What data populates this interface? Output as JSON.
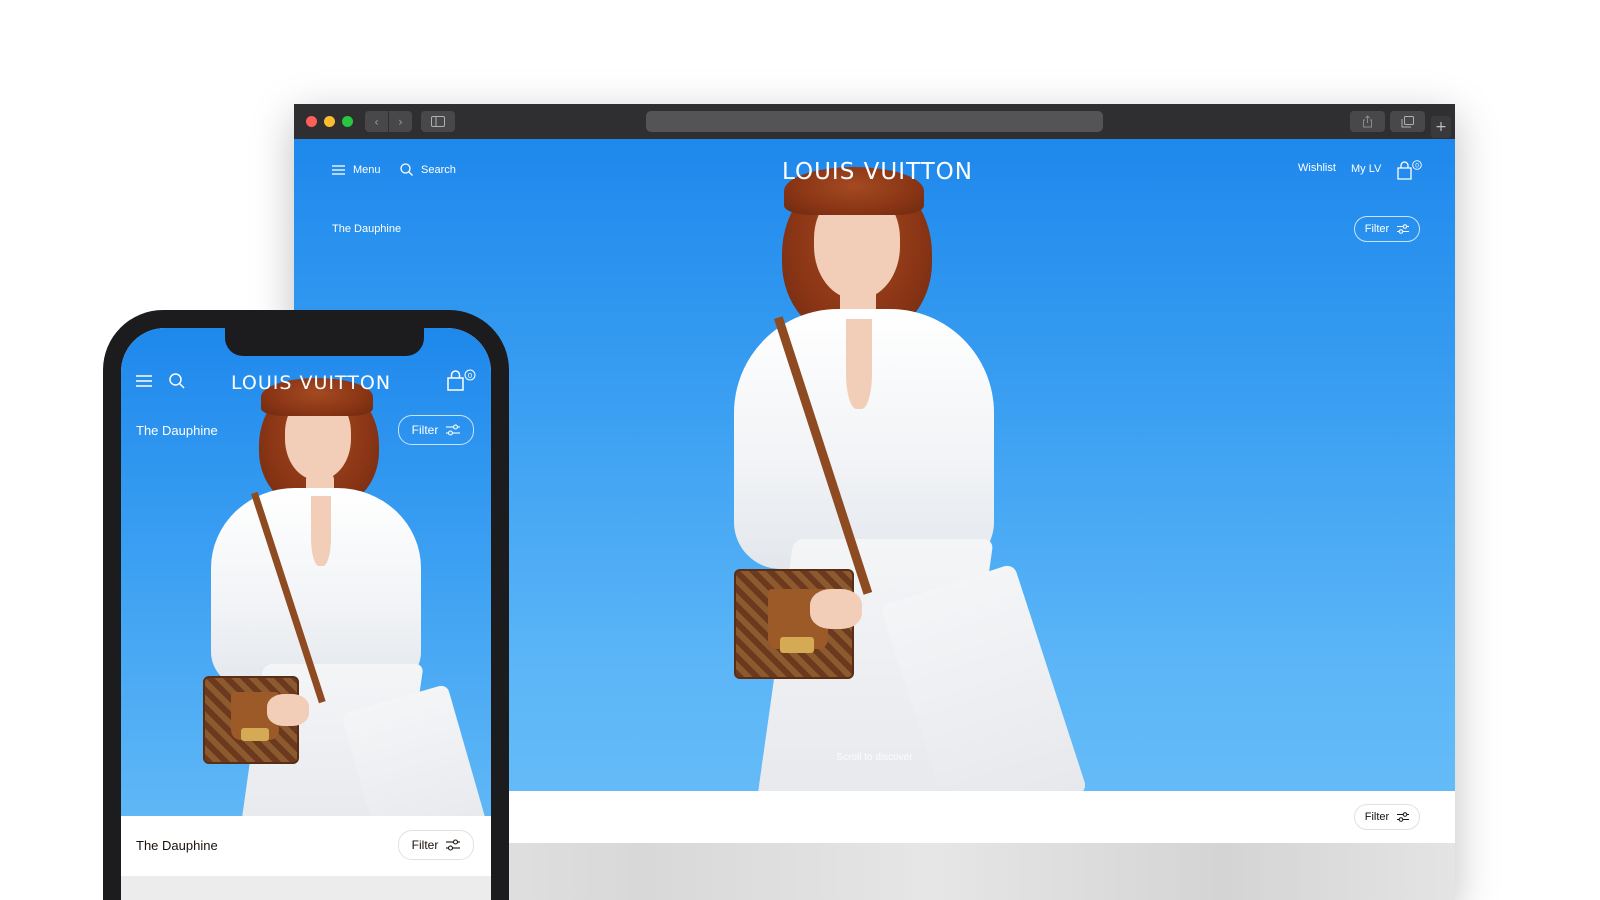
{
  "desktop": {
    "nav": {
      "menu_label": "Menu",
      "search_label": "Search",
      "wishlist_label": "Wishlist",
      "mylv_label": "My LV",
      "cart_count": "0"
    },
    "logo": "LOUIS VUITTON",
    "collection_title": "The Dauphine",
    "filter_label": "Filter",
    "scroll_hint": "Scroll to discover",
    "content_bar_filter_label": "Filter"
  },
  "mobile": {
    "logo": "LOUIS VUITTON",
    "cart_count": "0",
    "collection_title": "The Dauphine",
    "filter_label": "Filter",
    "bar_title": "The Dauphine",
    "bar_filter_label": "Filter"
  },
  "colors": {
    "hero_blue": "#1e88ec",
    "hero_blue_light": "#64bbf7",
    "brand_text": "#19110b",
    "browser_chrome": "#2f2f31"
  },
  "icons": {
    "menu": "hamburger-icon",
    "search": "search-icon",
    "cart": "shopping-bag-icon",
    "filter": "sliders-icon",
    "back": "chevron-left-icon",
    "forward": "chevron-right-icon",
    "sidebar": "sidebar-icon",
    "share": "share-icon",
    "tabs": "tabs-icon",
    "new_tab": "plus-icon"
  }
}
